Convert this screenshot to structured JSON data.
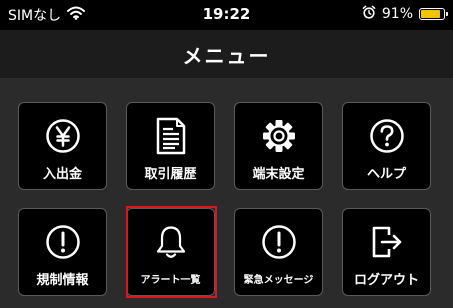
{
  "status_bar": {
    "carrier": "SIMなし",
    "time": "19:22",
    "battery_percent": "91%",
    "battery_level": 0.91,
    "icons": [
      "wifi-icon",
      "alarm-icon",
      "battery-icon"
    ]
  },
  "nav": {
    "title": "メニュー"
  },
  "menu": {
    "items": [
      {
        "label": "入出金",
        "icon": "yen-icon"
      },
      {
        "label": "取引履歴",
        "icon": "document-icon"
      },
      {
        "label": "端末設定",
        "icon": "gear-icon"
      },
      {
        "label": "ヘルプ",
        "icon": "question-icon"
      },
      {
        "label": "規制情報",
        "icon": "exclamation-icon"
      },
      {
        "label": "アラート一覧",
        "icon": "bell-icon",
        "highlighted": true
      },
      {
        "label": "緊急メッセージ",
        "icon": "exclamation-icon"
      },
      {
        "label": "ログアウト",
        "icon": "logout-icon"
      }
    ]
  },
  "colors": {
    "highlight": "#e0141b",
    "battery": "#f5c400",
    "tile_border": "#5a5a5a"
  }
}
